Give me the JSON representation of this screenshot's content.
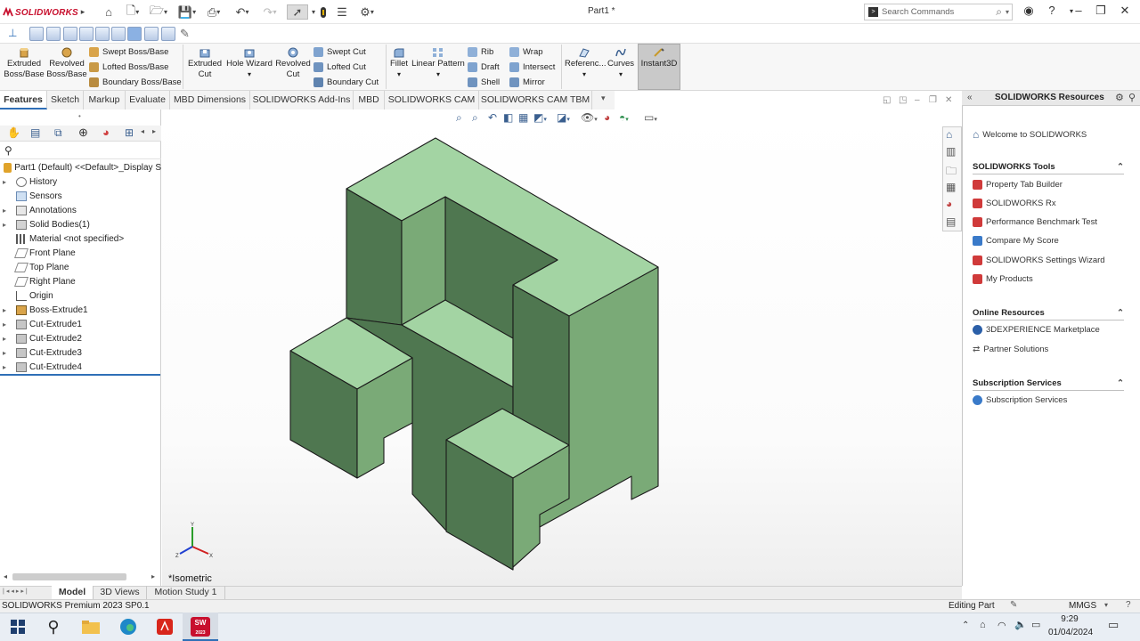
{
  "app": {
    "brand": "SOLIDWORKS",
    "document_title": "Part1 *"
  },
  "search": {
    "placeholder": "Search Commands"
  },
  "colors": {
    "part_top": "#a3d4a3",
    "part_front": "#4f7750",
    "part_side": "#7aaa77",
    "accent": "#2f6fb7",
    "brand": "#c8102e"
  },
  "ribbon": {
    "extruded_boss": [
      "Extruded",
      "Boss/Base"
    ],
    "revolved_boss": [
      "Revolved",
      "Boss/Base"
    ],
    "swept_boss": "Swept Boss/Base",
    "lofted_boss": "Lofted Boss/Base",
    "boundary_boss": "Boundary Boss/Base",
    "extruded_cut": [
      "Extruded",
      "Cut"
    ],
    "hole_wizard": "Hole Wizard",
    "revolved_cut": [
      "Revolved",
      "Cut"
    ],
    "swept_cut": "Swept Cut",
    "lofted_cut": "Lofted Cut",
    "boundary_cut": "Boundary Cut",
    "fillet": "Fillet",
    "linear_pattern": "Linear Pattern",
    "rib": "Rib",
    "draft": "Draft",
    "shell": "Shell",
    "wrap": "Wrap",
    "intersect": "Intersect",
    "mirror": "Mirror",
    "reference": "Referenc...",
    "curves": "Curves",
    "instant3d": "Instant3D"
  },
  "tabs": [
    "Features",
    "Sketch",
    "Markup",
    "Evaluate",
    "MBD Dimensions",
    "SOLIDWORKS Add-Ins",
    "MBD",
    "SOLIDWORKS CAM",
    "SOLIDWORKS CAM TBM"
  ],
  "tree": {
    "root": "Part1 (Default) <<Default>_Display S",
    "items": [
      "History",
      "Sensors",
      "Annotations",
      "Solid Bodies(1)",
      "Material <not specified>",
      "Front Plane",
      "Top Plane",
      "Right Plane",
      "Origin",
      "Boss-Extrude1",
      "Cut-Extrude1",
      "Cut-Extrude2",
      "Cut-Extrude3",
      "Cut-Extrude4"
    ]
  },
  "viewport": {
    "view_name": "*Isometric",
    "triad": {
      "x": "X",
      "y": "Y",
      "z": "Z"
    }
  },
  "resources": {
    "header": "SOLIDWORKS Resources",
    "welcome": "Welcome to SOLIDWORKS",
    "tools_title": "SOLIDWORKS Tools",
    "tools": [
      "Property Tab Builder",
      "SOLIDWORKS Rx",
      "Performance Benchmark Test",
      "Compare My Score",
      "SOLIDWORKS Settings Wizard",
      "My Products"
    ],
    "online_title": "Online Resources",
    "online": [
      "3DEXPERIENCE Marketplace",
      "Partner Solutions"
    ],
    "subs_title": "Subscription Services",
    "subs": [
      "Subscription Services"
    ]
  },
  "bottom_tabs": [
    "Model",
    "3D Views",
    "Motion Study 1"
  ],
  "status": {
    "product": "SOLIDWORKS Premium 2023 SP0.1",
    "mode": "Editing Part",
    "units": "MMGS"
  },
  "taskbar": {
    "time": "9:29",
    "date": "01/04/2024",
    "sw_badge": "2023"
  }
}
